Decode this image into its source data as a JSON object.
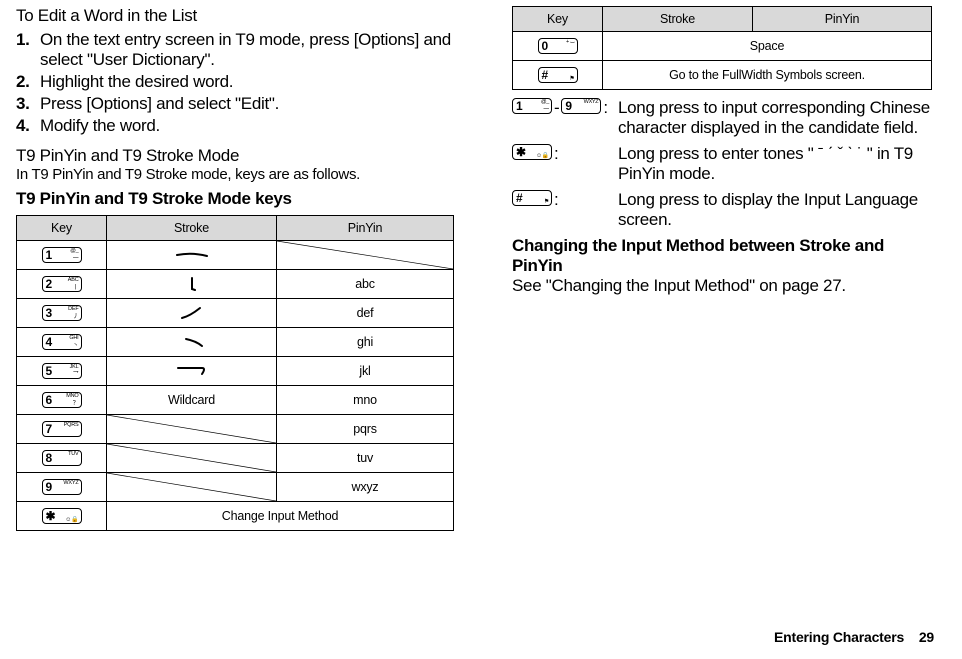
{
  "left": {
    "heading_edit": "To Edit a Word in the List",
    "steps": [
      "On the text entry screen in T9 mode, press [Options] and select \"User Dictionary\".",
      "Highlight the desired word.",
      "Press [Options] and select \"Edit\".",
      "Modify the word."
    ],
    "heading_mode": "T9 PinYin and T9 Stroke Mode",
    "mode_intro": "In T9 PinYin and T9 Stroke mode, keys are as follows.",
    "heading_keys": "T9 PinYin and T9 Stroke Mode keys",
    "table1_headers": [
      "Key",
      "Stroke",
      "PinYin"
    ],
    "rows1": [
      {
        "key": {
          "big": "1",
          "sup": "@_",
          "sub": "一"
        },
        "stroke_svg": "heng",
        "pinyin_diag": true
      },
      {
        "key": {
          "big": "2",
          "sup": "ABC",
          "sub": "丨"
        },
        "stroke_svg": "shu",
        "pinyin": "abc"
      },
      {
        "key": {
          "big": "3",
          "sup": "DEF",
          "sub": "丿"
        },
        "stroke_svg": "pie",
        "pinyin": "def"
      },
      {
        "key": {
          "big": "4",
          "sup": "GHI",
          "sub": "丶"
        },
        "stroke_svg": "dian",
        "pinyin": "ghi"
      },
      {
        "key": {
          "big": "5",
          "sup": "JKL",
          "sub": "乛"
        },
        "stroke_svg": "zhe",
        "pinyin": "jkl"
      },
      {
        "key": {
          "big": "6",
          "sup": "MNO",
          "sub": "？"
        },
        "stroke_text": "Wildcard",
        "pinyin": "mno"
      },
      {
        "key": {
          "big": "7",
          "sup": "PQRS",
          "sub": ""
        },
        "stroke_diag": true,
        "pinyin": "pqrs"
      },
      {
        "key": {
          "big": "8",
          "sup": "TUV",
          "sub": ""
        },
        "stroke_diag": true,
        "pinyin": "tuv"
      },
      {
        "key": {
          "big": "9",
          "sup": "WXYZ",
          "sub": ""
        },
        "stroke_diag": true,
        "pinyin": "wxyz"
      },
      {
        "key": {
          "big": "✱",
          "sup": "",
          "sub": "☺🔒"
        },
        "span": "Change Input Method"
      }
    ]
  },
  "right": {
    "table2_headers": [
      "Key",
      "Stroke",
      "PinYin"
    ],
    "rows2": [
      {
        "key": {
          "big": "0",
          "sup": "+ ⌴",
          "sub": ""
        },
        "span": "Space"
      },
      {
        "key": {
          "big": "#",
          "sup": "",
          "sub": "⚑"
        },
        "span": "Go to the FullWidth Symbols screen."
      }
    ],
    "def1_keys_a": {
      "big": "1",
      "sup": "@_",
      "sub": "一"
    },
    "def1_dash": "-",
    "def1_keys_b": {
      "big": "9",
      "sup": "WXYZ",
      "sub": ""
    },
    "def1_colon": ":",
    "def1_text": "Long press to input corresponding Chinese character displayed in the candidate field.",
    "def2_key": {
      "big": "✱",
      "sup": "",
      "sub": "☺🔒"
    },
    "def2_colon": ":",
    "def2_text": "Long press to enter tones \" ˉ ˊ ˇ ˋ ˙ \" in T9 PinYin mode.",
    "def3_key": {
      "big": "#",
      "sup": "",
      "sub": "⚑"
    },
    "def3_colon": ":",
    "def3_text": "Long press to display the Input Language screen.",
    "heading_change": "Changing the Input Method between Stroke and PinYin",
    "p_change": "See \"Changing the Input Method\" on page 27."
  },
  "footer": {
    "label": "Entering Characters",
    "page": "29"
  }
}
